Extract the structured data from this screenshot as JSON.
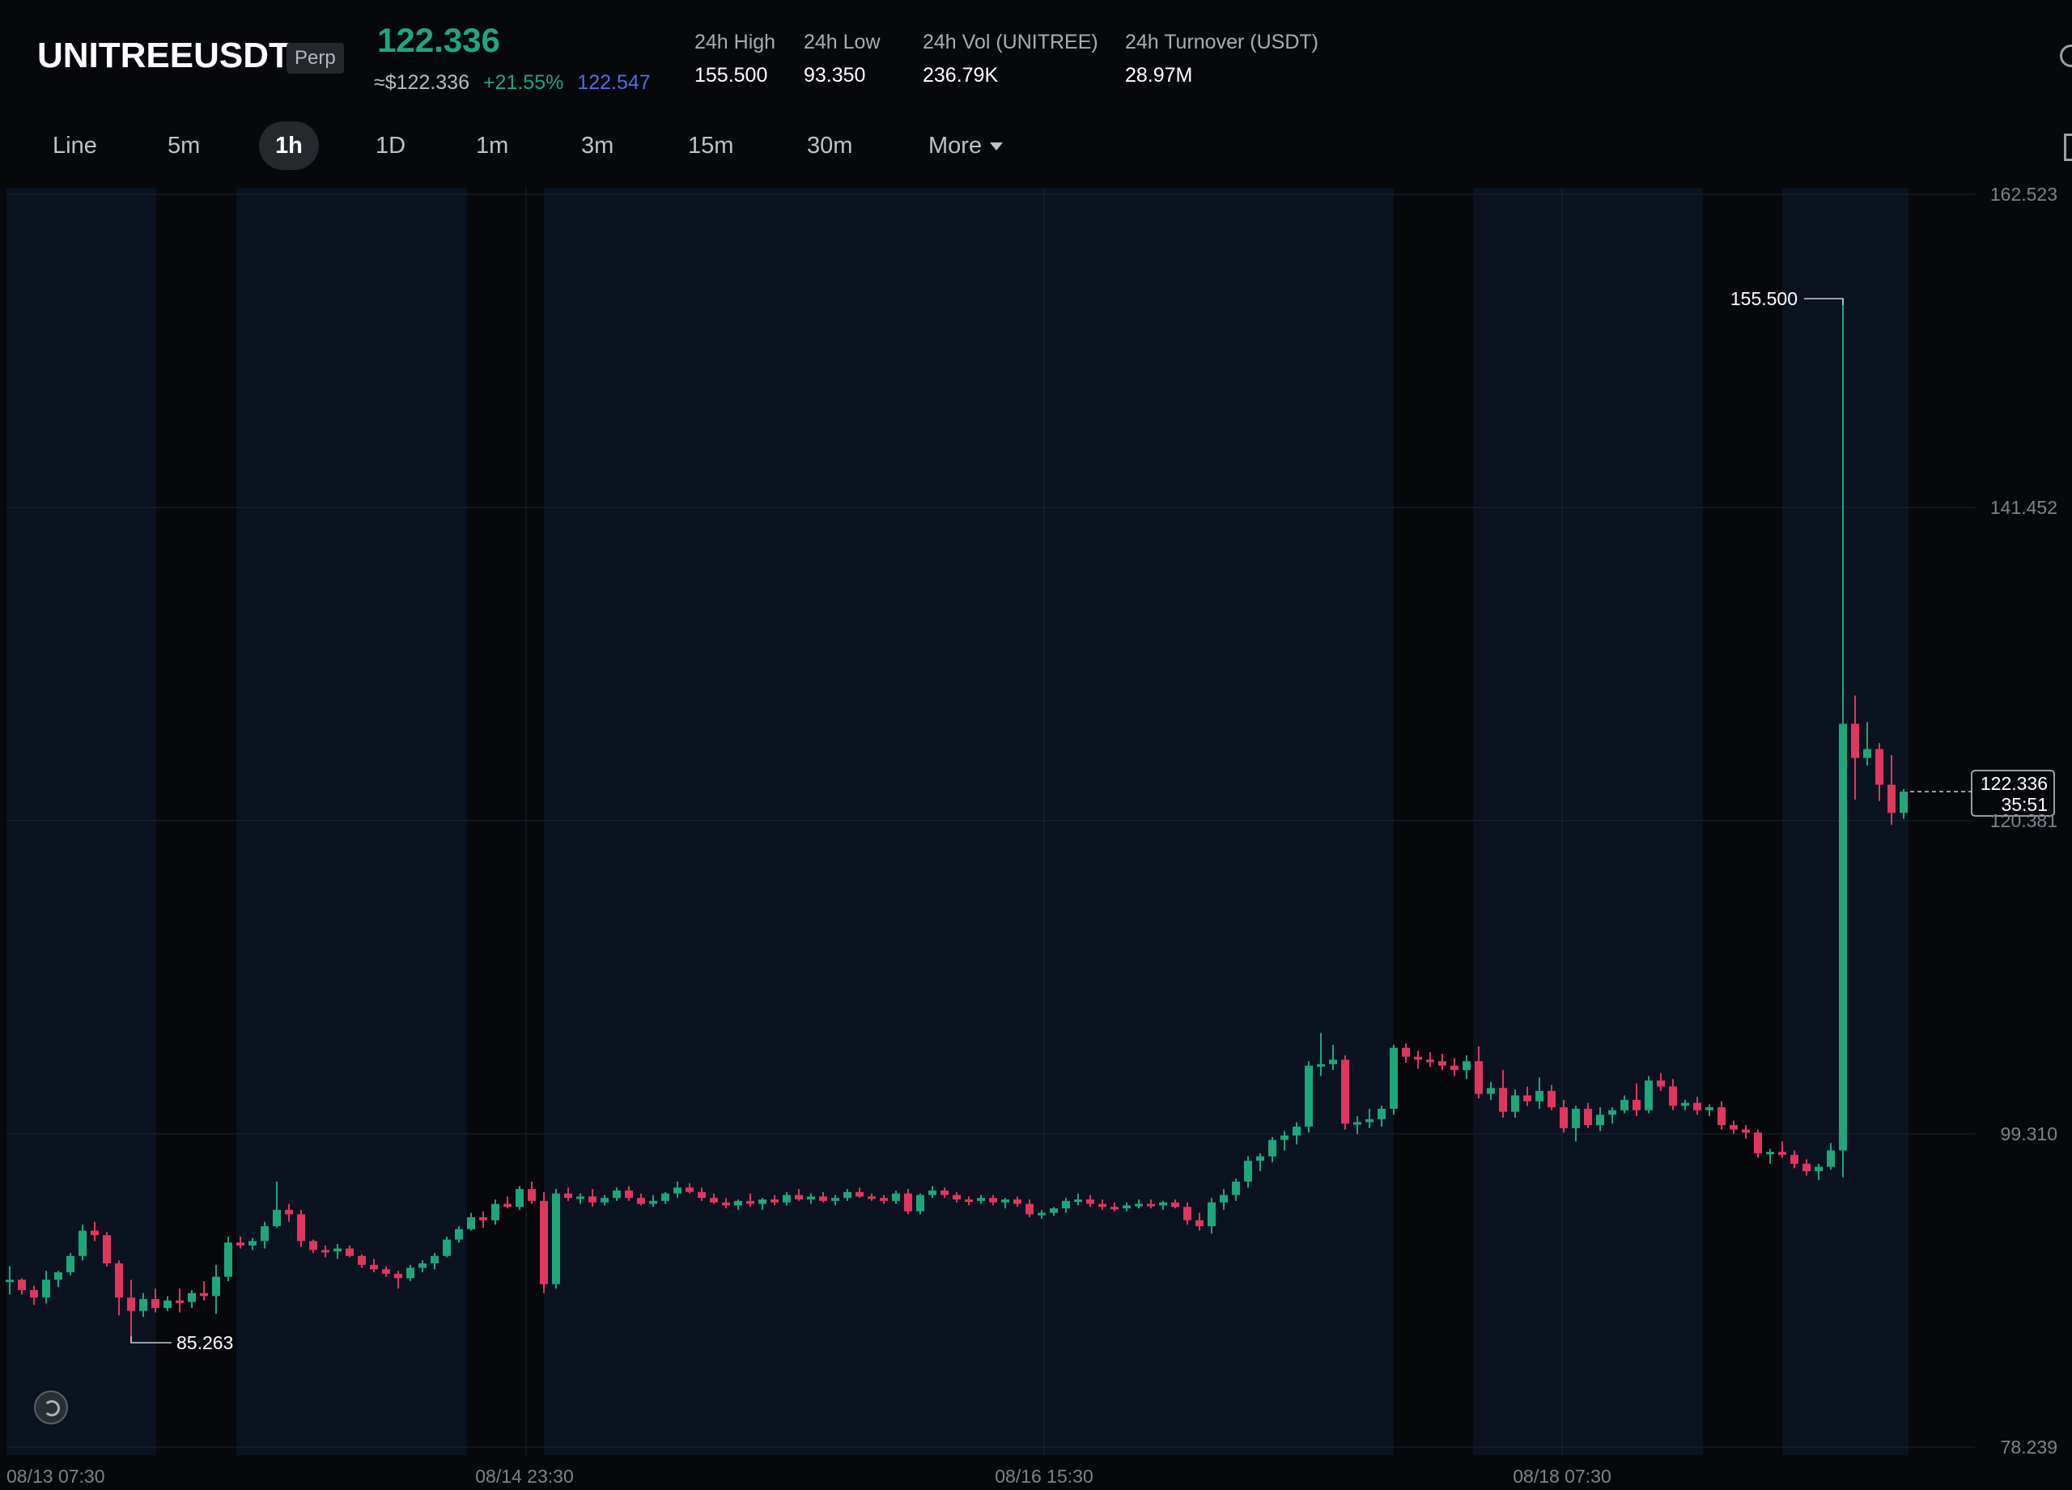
{
  "header": {
    "symbol": "UNITREEUSDT",
    "contract_type": "Perp",
    "last_price": "122.336",
    "usd_price": "≈$122.336",
    "change_pct": "+21.55%",
    "mark_price": "122.547",
    "stats": [
      {
        "label": "24h  High",
        "value": "155.500"
      },
      {
        "label": "24h  Low",
        "value": "93.350"
      },
      {
        "label": "24h  Vol (UNITREE)",
        "value": "236.79K"
      },
      {
        "label": "24h  Turnover (USDT)",
        "value": "28.97M"
      }
    ]
  },
  "tabs": [
    "Line",
    "5m",
    "1h",
    "1D",
    "1m",
    "3m",
    "15m",
    "30m",
    "More"
  ],
  "active_tab": "1h",
  "colors": {
    "up": "#1fa67a",
    "down": "#e0375f",
    "bg": "#06080b",
    "panel": "#0b1320",
    "mark": "#4d6fe0"
  },
  "icons": [
    "search-icon",
    "expand-icon",
    "watermark-logo-icon"
  ],
  "chart_data": {
    "type": "candlestick",
    "y_ticks": [
      "162.523",
      "141.452",
      "120.381",
      "99.310",
      "78.239"
    ],
    "x_ticks": [
      "08/13 07:30",
      "08/14 23:30",
      "08/16 15:30",
      "08/18 07:30"
    ],
    "ylim": [
      78.239,
      162.523
    ],
    "high_marker": "155.500",
    "low_marker": "85.263",
    "current_price_tag": "122.336",
    "countdown": "35:51",
    "grid": true,
    "candles": [
      [
        89.4,
        90.4,
        88.5,
        89.5
      ],
      [
        89.5,
        89.6,
        88.5,
        88.8
      ],
      [
        88.8,
        89.1,
        87.8,
        88.3
      ],
      [
        88.3,
        90.1,
        87.9,
        89.5
      ],
      [
        89.5,
        90.1,
        89.0,
        90.0
      ],
      [
        90.0,
        91.3,
        89.8,
        91.1
      ],
      [
        91.1,
        93.2,
        90.8,
        92.8
      ],
      [
        92.8,
        93.4,
        92.1,
        92.5
      ],
      [
        92.5,
        92.7,
        90.4,
        90.6
      ],
      [
        90.6,
        90.8,
        87.1,
        88.3
      ],
      [
        88.3,
        89.5,
        85.26,
        87.4
      ],
      [
        87.4,
        88.6,
        87.0,
        88.2
      ],
      [
        88.2,
        88.9,
        87.3,
        87.6
      ],
      [
        87.6,
        88.4,
        87.4,
        88.1
      ],
      [
        88.1,
        88.9,
        87.3,
        88.0
      ],
      [
        88.0,
        88.8,
        87.6,
        88.6
      ],
      [
        88.6,
        89.4,
        88.1,
        88.4
      ],
      [
        88.4,
        90.5,
        87.2,
        89.7
      ],
      [
        89.7,
        92.4,
        89.4,
        92.0
      ],
      [
        92.0,
        92.4,
        91.6,
        91.8
      ],
      [
        91.8,
        92.3,
        91.5,
        92.1
      ],
      [
        92.1,
        93.4,
        91.6,
        93.1
      ],
      [
        93.1,
        96.1,
        93.0,
        94.2
      ],
      [
        94.2,
        94.6,
        93.4,
        93.9
      ],
      [
        93.9,
        94.2,
        91.7,
        92.1
      ],
      [
        92.1,
        92.2,
        91.3,
        91.5
      ],
      [
        91.5,
        91.8,
        91.0,
        91.4
      ],
      [
        91.4,
        91.9,
        90.9,
        91.6
      ],
      [
        91.6,
        91.8,
        91.0,
        91.1
      ],
      [
        91.1,
        91.2,
        90.3,
        90.5
      ],
      [
        90.5,
        90.9,
        90.0,
        90.2
      ],
      [
        90.2,
        90.4,
        89.7,
        89.9
      ],
      [
        89.9,
        90.1,
        88.9,
        89.6
      ],
      [
        89.6,
        90.5,
        89.4,
        90.3
      ],
      [
        90.3,
        90.8,
        90.0,
        90.6
      ],
      [
        90.6,
        91.3,
        90.2,
        91.1
      ],
      [
        91.1,
        92.4,
        91.0,
        92.2
      ],
      [
        92.2,
        93.1,
        92.0,
        92.9
      ],
      [
        92.9,
        94.0,
        92.8,
        93.7
      ],
      [
        93.7,
        94.1,
        93.0,
        93.5
      ],
      [
        93.5,
        94.9,
        93.2,
        94.6
      ],
      [
        94.6,
        95.1,
        94.3,
        94.4
      ],
      [
        94.4,
        95.8,
        94.2,
        95.6
      ],
      [
        95.6,
        96.1,
        94.6,
        94.8
      ],
      [
        94.8,
        95.4,
        88.6,
        89.2
      ],
      [
        89.2,
        95.6,
        88.9,
        95.3
      ],
      [
        95.3,
        95.7,
        94.8,
        95.0
      ],
      [
        95.0,
        95.3,
        94.6,
        95.1
      ],
      [
        95.1,
        95.6,
        94.4,
        94.7
      ],
      [
        94.7,
        95.2,
        94.5,
        95.0
      ],
      [
        95.0,
        95.7,
        94.8,
        95.5
      ],
      [
        95.5,
        95.8,
        94.8,
        95.0
      ],
      [
        95.0,
        95.3,
        94.5,
        94.6
      ],
      [
        94.6,
        95.2,
        94.4,
        94.8
      ],
      [
        94.8,
        95.4,
        94.6,
        95.3
      ],
      [
        95.3,
        96.1,
        95.0,
        95.7
      ],
      [
        95.7,
        96.0,
        95.3,
        95.4
      ],
      [
        95.4,
        95.7,
        94.8,
        95.0
      ],
      [
        95.0,
        95.3,
        94.6,
        94.7
      ],
      [
        94.7,
        95.0,
        94.3,
        94.5
      ],
      [
        94.5,
        94.9,
        94.2,
        94.8
      ],
      [
        94.8,
        95.3,
        94.4,
        94.6
      ],
      [
        94.6,
        95.0,
        94.2,
        94.9
      ],
      [
        94.9,
        95.2,
        94.5,
        94.7
      ],
      [
        94.7,
        95.4,
        94.5,
        95.2
      ],
      [
        95.2,
        95.6,
        94.8,
        94.9
      ],
      [
        94.9,
        95.3,
        94.6,
        95.1
      ],
      [
        95.1,
        95.4,
        94.7,
        94.8
      ],
      [
        94.8,
        95.2,
        94.5,
        95.0
      ],
      [
        95.0,
        95.6,
        94.8,
        95.4
      ],
      [
        95.4,
        95.7,
        95.0,
        95.1
      ],
      [
        95.1,
        95.3,
        94.8,
        95.0
      ],
      [
        95.0,
        95.2,
        94.6,
        94.8
      ],
      [
        94.8,
        95.5,
        94.6,
        95.3
      ],
      [
        95.3,
        95.6,
        93.9,
        94.1
      ],
      [
        94.1,
        95.3,
        93.9,
        95.2
      ],
      [
        95.2,
        95.8,
        95.0,
        95.5
      ],
      [
        95.5,
        95.7,
        95.0,
        95.2
      ],
      [
        95.2,
        95.4,
        94.7,
        94.9
      ],
      [
        94.9,
        95.1,
        94.5,
        94.8
      ],
      [
        94.8,
        95.2,
        94.6,
        95.0
      ],
      [
        95.0,
        95.2,
        94.5,
        94.7
      ],
      [
        94.7,
        95.0,
        94.3,
        94.9
      ],
      [
        94.9,
        95.1,
        94.4,
        94.6
      ],
      [
        94.6,
        94.9,
        93.7,
        93.9
      ],
      [
        93.9,
        94.2,
        93.6,
        94.0
      ],
      [
        94.0,
        94.4,
        93.8,
        94.3
      ],
      [
        94.3,
        95.0,
        94.0,
        94.8
      ],
      [
        94.8,
        95.3,
        94.5,
        94.9
      ],
      [
        94.9,
        95.2,
        94.4,
        94.6
      ],
      [
        94.6,
        94.9,
        94.2,
        94.4
      ],
      [
        94.4,
        94.7,
        94.1,
        94.3
      ],
      [
        94.3,
        94.7,
        94.1,
        94.5
      ],
      [
        94.5,
        94.9,
        94.3,
        94.6
      ],
      [
        94.6,
        94.9,
        94.3,
        94.5
      ],
      [
        94.5,
        94.8,
        94.2,
        94.7
      ],
      [
        94.7,
        94.9,
        94.3,
        94.4
      ],
      [
        94.4,
        94.7,
        93.2,
        93.5
      ],
      [
        93.5,
        94.0,
        92.8,
        93.1
      ],
      [
        93.1,
        95.0,
        92.6,
        94.7
      ],
      [
        94.7,
        95.6,
        94.2,
        95.2
      ],
      [
        95.2,
        96.3,
        94.8,
        96.1
      ],
      [
        96.1,
        97.8,
        95.7,
        97.5
      ],
      [
        97.5,
        98.0,
        96.8,
        97.8
      ],
      [
        97.8,
        99.1,
        97.4,
        98.9
      ],
      [
        98.9,
        99.5,
        98.2,
        99.2
      ],
      [
        99.2,
        100.1,
        98.6,
        99.8
      ],
      [
        99.8,
        104.2,
        99.4,
        103.9
      ],
      [
        103.9,
        106.1,
        103.2,
        104.0
      ],
      [
        104.0,
        105.3,
        103.6,
        104.3
      ],
      [
        104.3,
        104.6,
        99.6,
        100.0
      ],
      [
        100.0,
        100.5,
        99.3,
        100.1
      ],
      [
        100.1,
        101.0,
        99.7,
        100.3
      ],
      [
        100.3,
        101.2,
        99.8,
        101.0
      ],
      [
        101.0,
        105.3,
        100.6,
        105.1
      ],
      [
        105.1,
        105.4,
        104.1,
        104.5
      ],
      [
        104.5,
        104.9,
        103.7,
        104.3
      ],
      [
        104.3,
        104.8,
        103.8,
        104.2
      ],
      [
        104.2,
        104.7,
        103.6,
        103.9
      ],
      [
        103.9,
        104.4,
        103.2,
        103.6
      ],
      [
        103.6,
        104.6,
        103.0,
        104.2
      ],
      [
        104.2,
        105.2,
        101.7,
        102.0
      ],
      [
        102.0,
        102.8,
        101.6,
        102.4
      ],
      [
        102.4,
        103.6,
        100.4,
        100.8
      ],
      [
        100.8,
        102.3,
        100.4,
        101.9
      ],
      [
        101.9,
        102.5,
        101.2,
        101.5
      ],
      [
        101.5,
        103.1,
        101.0,
        102.2
      ],
      [
        102.2,
        102.6,
        100.9,
        101.1
      ],
      [
        101.1,
        101.6,
        99.4,
        99.7
      ],
      [
        99.7,
        101.2,
        98.8,
        101.0
      ],
      [
        101.0,
        101.4,
        99.7,
        99.9
      ],
      [
        99.9,
        101.1,
        99.5,
        100.6
      ],
      [
        100.6,
        101.1,
        100.0,
        100.9
      ],
      [
        100.9,
        101.9,
        100.7,
        101.6
      ],
      [
        101.6,
        102.7,
        100.5,
        100.9
      ],
      [
        100.9,
        103.2,
        100.7,
        102.9
      ],
      [
        102.9,
        103.4,
        102.2,
        102.5
      ],
      [
        102.5,
        103.0,
        100.9,
        101.2
      ],
      [
        101.2,
        101.6,
        100.9,
        101.4
      ],
      [
        101.4,
        101.8,
        100.6,
        100.9
      ],
      [
        100.9,
        101.3,
        100.5,
        101.1
      ],
      [
        101.1,
        101.5,
        99.6,
        99.9
      ],
      [
        99.9,
        100.2,
        99.3,
        99.6
      ],
      [
        99.6,
        99.9,
        99.0,
        99.4
      ],
      [
        99.4,
        99.6,
        97.7,
        98.0
      ],
      [
        98.0,
        98.3,
        97.3,
        98.1
      ],
      [
        98.1,
        98.8,
        97.7,
        97.9
      ],
      [
        97.9,
        98.2,
        97.0,
        97.3
      ],
      [
        97.3,
        97.6,
        96.5,
        96.8
      ],
      [
        96.8,
        97.3,
        96.2,
        97.1
      ],
      [
        97.1,
        98.7,
        96.9,
        98.2
      ],
      [
        98.2,
        155.5,
        96.4,
        126.9
      ],
      [
        126.9,
        128.8,
        121.8,
        124.6
      ],
      [
        124.6,
        127.0,
        124.1,
        125.2
      ],
      [
        125.2,
        125.6,
        121.7,
        122.8
      ],
      [
        122.8,
        124.8,
        120.1,
        120.9
      ],
      [
        120.9,
        122.5,
        120.5,
        122.336
      ]
    ]
  }
}
